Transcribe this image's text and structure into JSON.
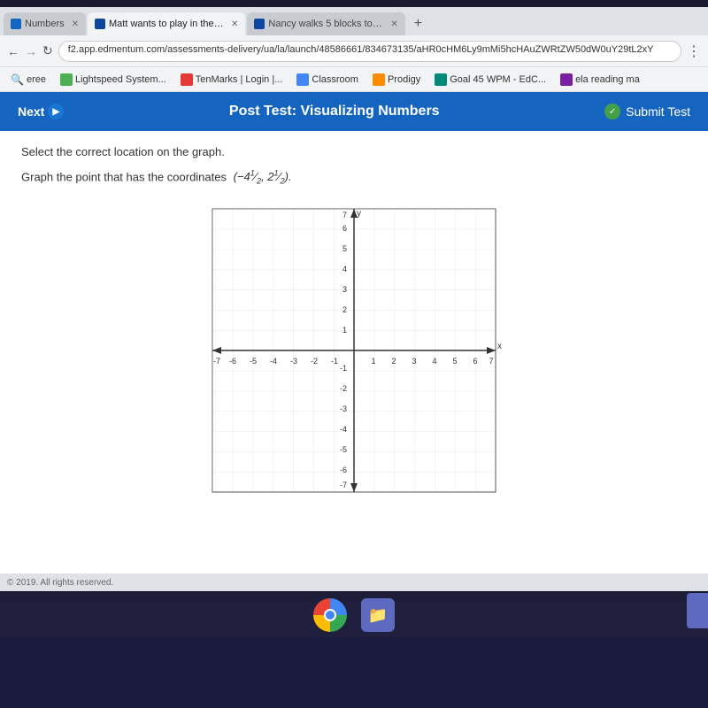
{
  "browser": {
    "tabs": [
      {
        "id": "tab1",
        "label": "Numbers",
        "active": false,
        "icon": "blue"
      },
      {
        "id": "tab2",
        "label": "Matt wants to play in the sand p",
        "active": true,
        "icon": "dark-blue"
      },
      {
        "id": "tab3",
        "label": "Nancy walks 5 blocks to the righ",
        "active": false,
        "icon": "dark-blue"
      }
    ],
    "address": "f2.app.edmentum.com/assessments-delivery/ua/la/launch/48586661/834673135/aHR0cHM6Ly9mMi5hcHAuZWRtZW50dW0uY29tL2xY"
  },
  "bookmarks": [
    {
      "label": "eree",
      "icon": "bm-search"
    },
    {
      "label": "Lightspeed System...",
      "icon": "bm-lightspeed"
    },
    {
      "label": "TenMarks | Login |...",
      "icon": "bm-tenmarks"
    },
    {
      "label": "Classroom",
      "icon": "bm-classroom"
    },
    {
      "label": "Prodigy",
      "icon": "bm-prodigy"
    },
    {
      "label": "Goal 45 WPM - EdC...",
      "icon": "bm-goal"
    },
    {
      "label": "ela reading ma",
      "icon": "bm-ela"
    }
  ],
  "toolbar": {
    "next_label": "Next",
    "title": "Post Test: Visualizing Numbers",
    "submit_label": "Submit Test"
  },
  "content": {
    "instruction": "Select the correct location on the graph.",
    "problem": "Graph the point that has the coordinates",
    "coordinates": "(-4½, 2½)",
    "coordinates_math": "\\left(-4\\tfrac{1}{2},\\,2\\tfrac{1}{2}\\right)"
  },
  "graph": {
    "x_min": -7,
    "x_max": 7,
    "y_min": -7,
    "y_max": 7,
    "x_label": "x",
    "y_label": "y"
  },
  "footer": {
    "copyright": "© 2019. All rights reserved."
  }
}
